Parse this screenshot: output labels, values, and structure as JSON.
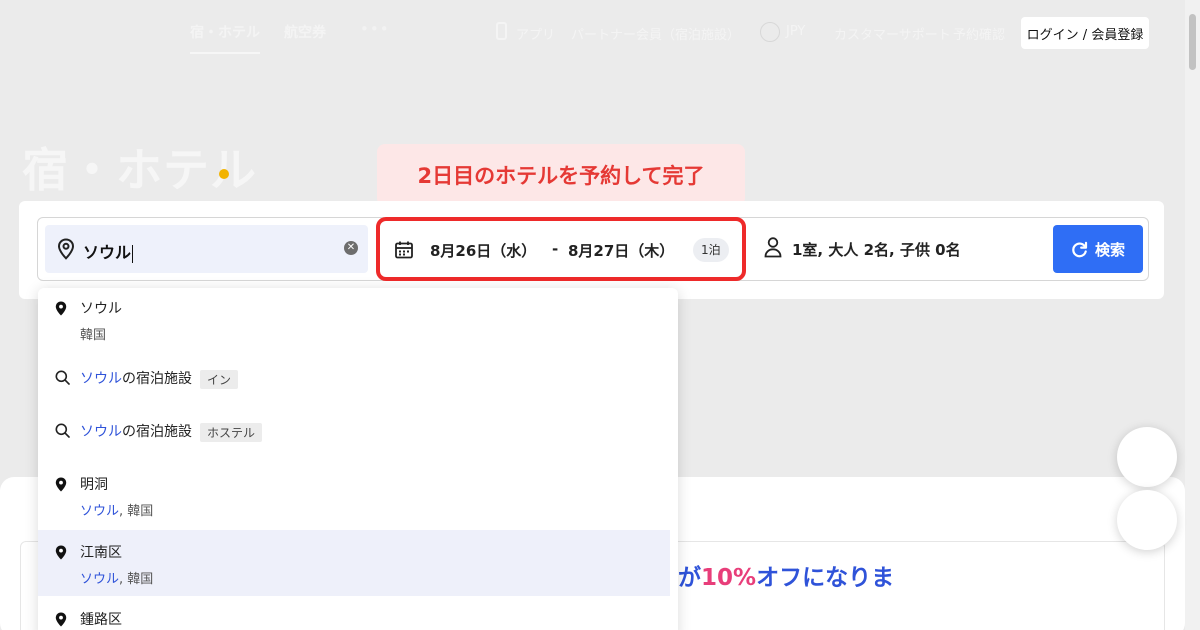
{
  "nav": {
    "tabs": [
      {
        "label": "宿・ホテル",
        "active": true
      },
      {
        "label": "航空券",
        "active": false
      }
    ],
    "more_label": "•••",
    "app_label": "アプリ",
    "partner_label": "パートナー会員（宿泊施設）",
    "currency_label": "JPY",
    "support_label": "カスタマーサポート",
    "booking_label": "予約確認",
    "login_label": "ログイン / 会員登録"
  },
  "hero": {
    "title": "宿・ホテル"
  },
  "callout": {
    "text": "2日目のホテルを予約して完了"
  },
  "search": {
    "destination_value": "ソウル",
    "checkin": "8月26日（水）",
    "separator": "-",
    "checkout": "8月27日（木）",
    "nights": "1泊",
    "guests": "1室, 大人 2名, 子供 0名",
    "search_label": "検索"
  },
  "suggestions": [
    {
      "icon": "pin-icon",
      "main_highlight": "ソウル",
      "main_rest": "",
      "sub": "韓国",
      "tag": ""
    },
    {
      "icon": "search-icon",
      "main_highlight": "ソウル",
      "main_rest": "の宿泊施設",
      "sub": "",
      "tag": "イン"
    },
    {
      "icon": "search-icon",
      "main_highlight": "ソウル",
      "main_rest": "の宿泊施設",
      "sub": "",
      "tag": "ホステル"
    },
    {
      "icon": "pin-icon",
      "main_highlight": "",
      "main_rest": "明洞",
      "sub_highlight": "ソウル",
      "sub": ", 韓国",
      "tag": ""
    },
    {
      "icon": "pin-icon",
      "main_highlight": "",
      "main_rest": "江南区",
      "sub_highlight": "ソウル",
      "sub": ", 韓国",
      "tag": "",
      "highlighted": true
    },
    {
      "icon": "pin-icon",
      "main_highlight": "",
      "main_rest": "鍾路区",
      "sub": "",
      "tag": ""
    }
  ],
  "promo": {
    "prefix": "約が",
    "percent": "10%",
    "suffix": "オフになりま"
  },
  "colors": {
    "accent": "#2f6ef5",
    "callout_red": "#ee2a2a",
    "hero_dot": "#f2b300",
    "promo_pink": "#e83e7a"
  }
}
